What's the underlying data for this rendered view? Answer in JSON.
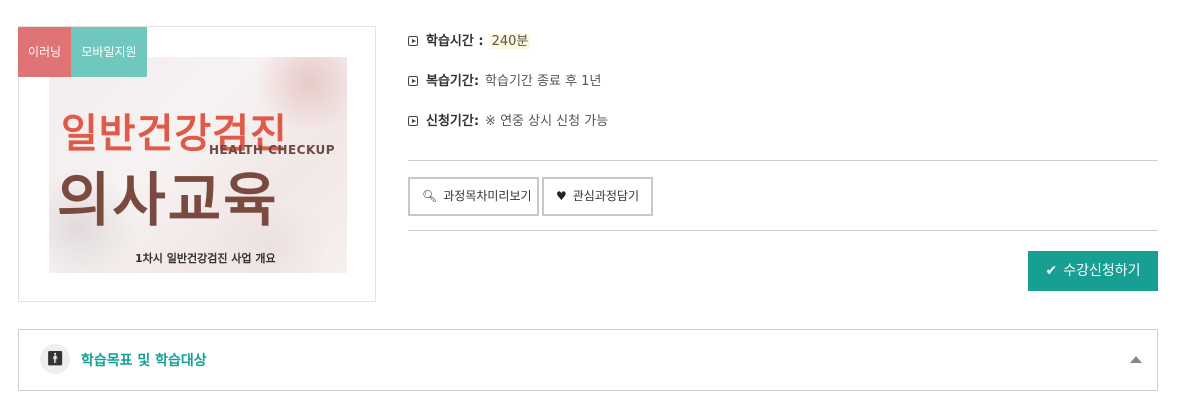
{
  "course": {
    "badges": [
      "이러닝",
      "모바일지원"
    ],
    "thumbnail": {
      "title_top": "일반건강검진",
      "title_en": "HEALTH CHECKUP",
      "title_bottom": "의사교육",
      "subtitle": "1차시 일반건강검진 사업 개요"
    },
    "info": [
      {
        "label": "학습시간 :",
        "value": "240분"
      },
      {
        "label": "복습기간:",
        "value": "학습기간 종료 후 1년"
      },
      {
        "label": "신청기간:",
        "value": "※ 연중 상시 신청 가능"
      }
    ],
    "buttons": {
      "preview": "과정목차미리보기",
      "wishlist": "관심과정담기",
      "apply": "수강신청하기"
    },
    "accordion": {
      "title": "학습목표 및 학습대상"
    }
  },
  "colors": {
    "accent": "#189f94",
    "badge_elearning": "#e07373",
    "badge_mobile": "#6fc7bd"
  },
  "icons": [
    "play-square-icon",
    "zoom-icon",
    "heart-icon",
    "check-icon",
    "person-icon",
    "caret-up-icon"
  ]
}
